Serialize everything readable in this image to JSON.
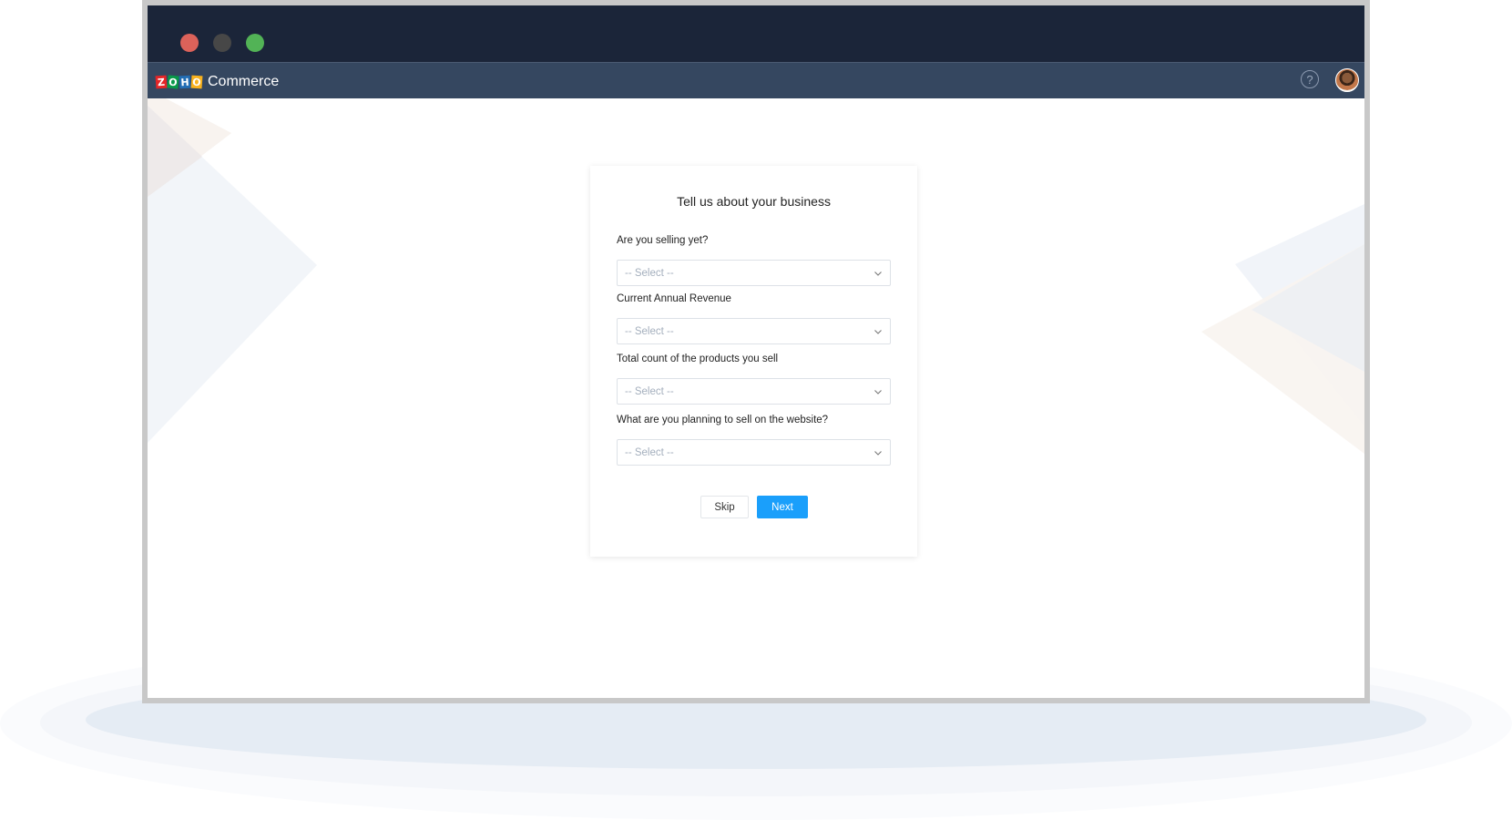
{
  "window": {
    "traffic_lights": [
      {
        "name": "close",
        "color": "#dc625a"
      },
      {
        "name": "minimize",
        "color": "#474747"
      },
      {
        "name": "maximize",
        "color": "#52b356"
      }
    ]
  },
  "appbar": {
    "logo_letters": [
      "Z",
      "O",
      "H",
      "O"
    ],
    "brand_name": "Commerce",
    "help_icon": "help-circle-icon",
    "help_glyph": "?",
    "avatar_icon": "user-avatar"
  },
  "form": {
    "title": "Tell us about your business",
    "fields": [
      {
        "label": "Are you selling yet?",
        "placeholder": "-- Select --"
      },
      {
        "label": "Current Annual Revenue",
        "placeholder": "-- Select --"
      },
      {
        "label": "Total count of the products you sell",
        "placeholder": "-- Select --"
      },
      {
        "label": "What are you planning to sell on the website?",
        "placeholder": "-- Select --"
      }
    ],
    "skip_label": "Skip",
    "next_label": "Next"
  },
  "colors": {
    "titlebar": "#1b2539",
    "appbar": "#354760",
    "primary_button": "#1a9ffb"
  }
}
